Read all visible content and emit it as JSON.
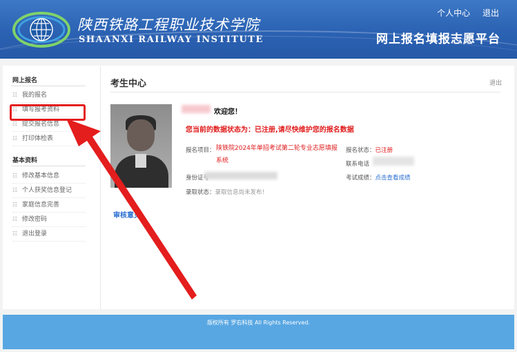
{
  "header": {
    "school_name_cn": "陕西铁路工程职业技术学院",
    "school_name_en": "SHAANXI  RAILWAY  INSTITUTE",
    "personal_center": "个人中心",
    "logout": "退出",
    "platform_title": "网上报名填报志愿平台",
    "bg_color": "#2b62b3"
  },
  "sidebar": {
    "section1_title": "网上报名",
    "section1_items": [
      "我的报名",
      "填写报考资料",
      "提交报名信息",
      "打印体检表"
    ],
    "section2_title": "基本资料",
    "section2_items": [
      "修改基本信息",
      "个人获奖信息登记",
      "家庭信息完善",
      "修改密码",
      "退出登录"
    ]
  },
  "content": {
    "title": "考生中心",
    "logout": "退出",
    "welcome": "欢迎您！",
    "status_message": "您当前的数据状态为：已注册,请尽快维护您的报名数据",
    "project_label": "报名项目：",
    "project_value": "陕铁院2024年单招考试第二轮专业志愿填报系统",
    "status_label": "报名状态：",
    "status_value": "已注册",
    "phone_label": "联系电话",
    "id_label": "身份证号",
    "score_label": "考试成绩：",
    "score_link": "点击查看成绩",
    "admission_label": "录取状态：",
    "admission_value": "录取信息尚未发布！",
    "audit_opinion": "审核意见",
    "accent_red": "#e01b1b",
    "accent_blue": "#2a6fd1"
  },
  "footer": {
    "copyright": "版权所有 罗右科技 All Rights Reserved.",
    "bg_color": "#58a7e3"
  }
}
